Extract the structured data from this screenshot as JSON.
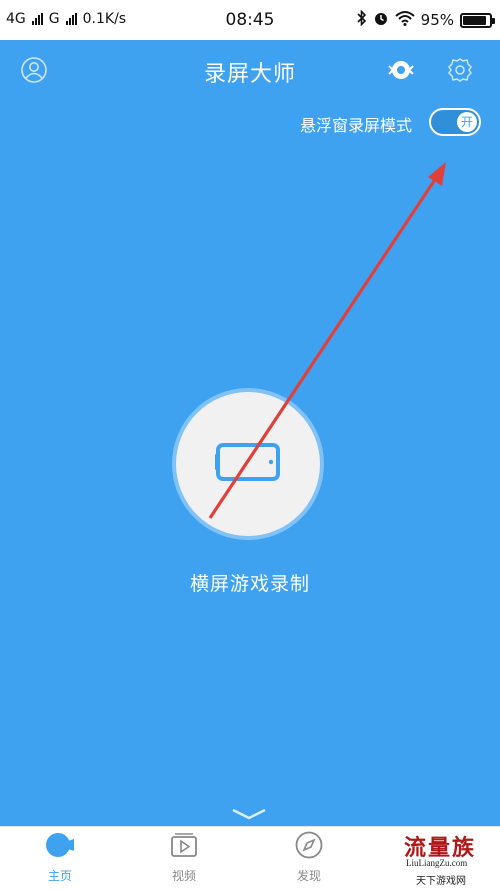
{
  "status_bar": {
    "network1": "4G",
    "network2": "G",
    "speed": "0.1K/s",
    "time": "08:45",
    "battery_text": "95%",
    "battery_level": 0.95
  },
  "header": {
    "title": "录屏大师",
    "profile_icon": "user-circle-icon",
    "floating_icon": "floating-window-icon",
    "settings_icon": "gear-icon"
  },
  "float_mode": {
    "label": "悬浮窗录屏模式",
    "toggle_text": "开",
    "enabled": true
  },
  "record": {
    "label": "横屏游戏录制",
    "icon": "landscape-phone-icon"
  },
  "tabs": [
    {
      "label": "主页",
      "icon": "camera-icon",
      "active": true
    },
    {
      "label": "视频",
      "icon": "video-icon",
      "active": false
    },
    {
      "label": "发现",
      "icon": "compass-icon",
      "active": false
    }
  ],
  "watermark": {
    "logo": "流量族",
    "url": "LiuLiangZu.com",
    "sub": "天下游戏网"
  },
  "colors": {
    "primary": "#3ea2f1",
    "arrow": "#e0403b",
    "tab_inactive": "#888888"
  }
}
